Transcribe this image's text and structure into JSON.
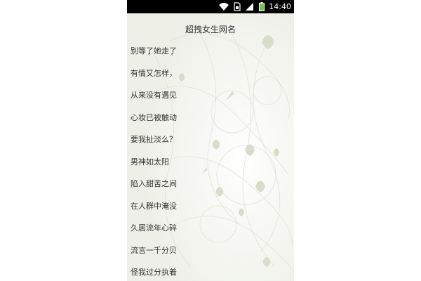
{
  "status_bar": {
    "time": "14:40",
    "icons": [
      "wifi-icon",
      "sim-icon",
      "signal-icon",
      "battery-icon"
    ],
    "battery_color": "#7ac143"
  },
  "screen": {
    "title": "超拽女生网名",
    "background_color": "#f2f3ee",
    "text_color": "#333333"
  },
  "names": [
    "别等了她走了",
    "有情又怎样，",
    "从来没有遇见",
    "心妆已被触动",
    "要我扯淡么？",
    "男神如太阳",
    "陷入甜苦之间",
    "在人群中淹没",
    "久居流年心碎",
    "流言一千分贝",
    "怪我过分执着"
  ]
}
